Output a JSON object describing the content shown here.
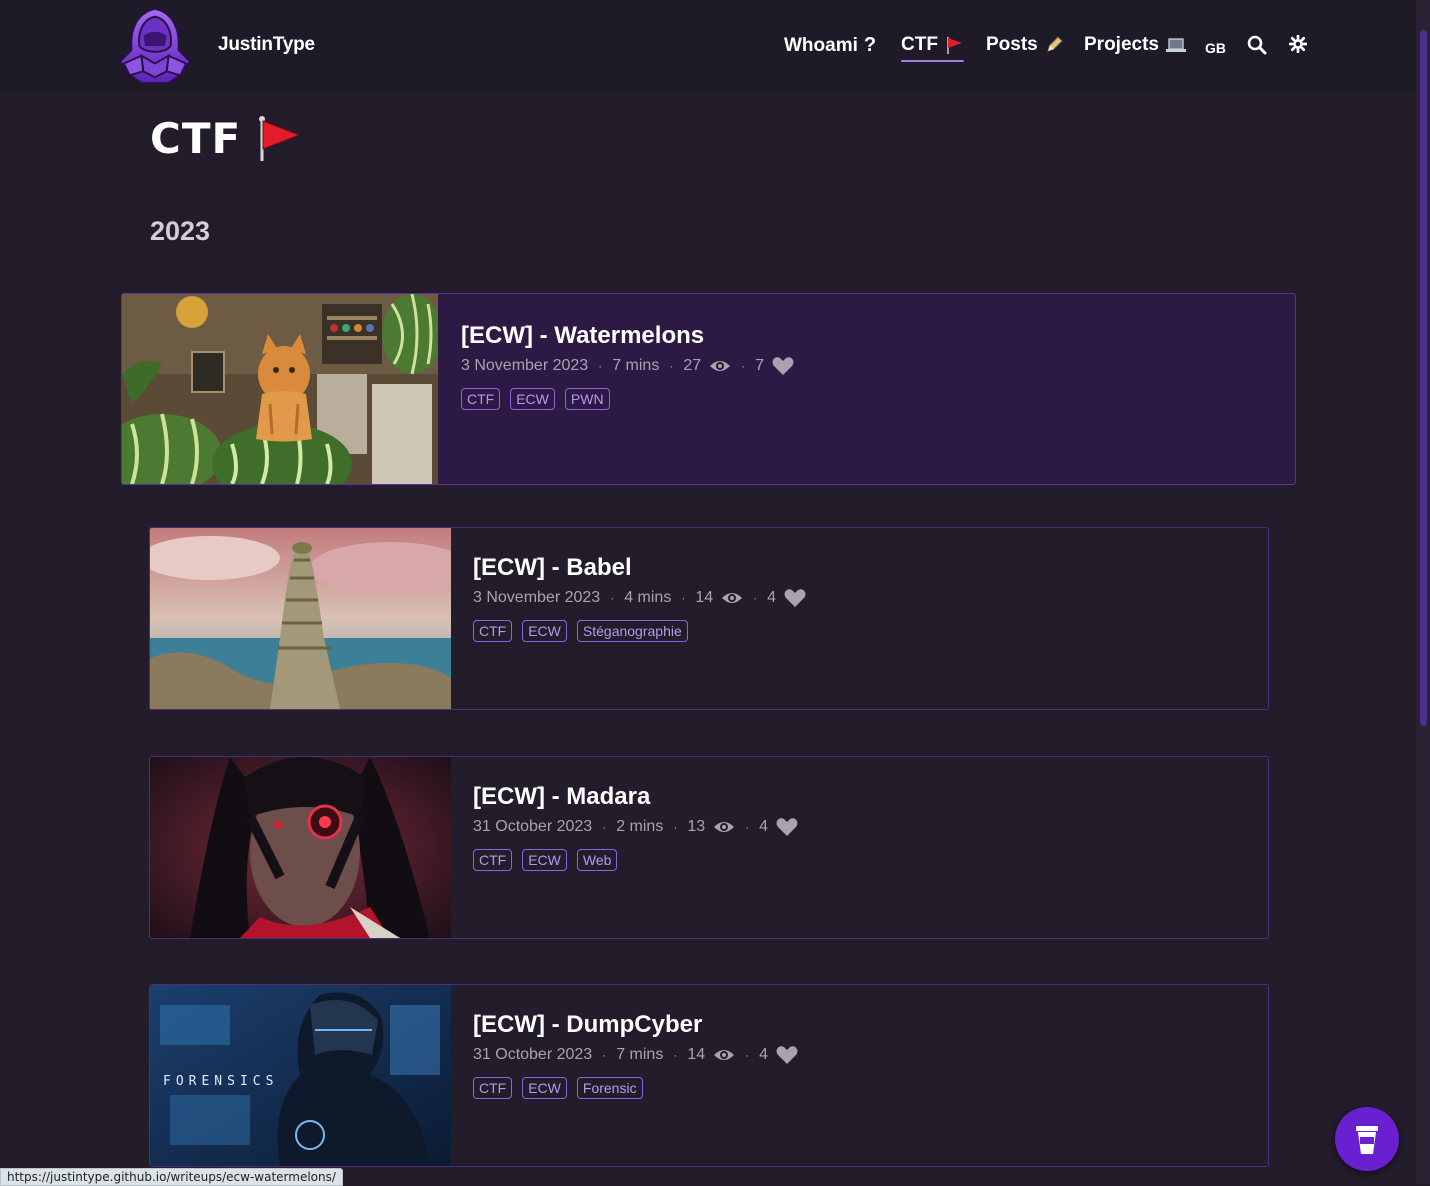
{
  "header": {
    "site_title": "JustinType",
    "nav": [
      {
        "label": "Whoami",
        "icon": "question-icon",
        "glyph": "?"
      },
      {
        "label": "CTF",
        "icon": "red-flag-icon",
        "active": true
      },
      {
        "label": "Posts",
        "icon": "pencil-icon"
      },
      {
        "label": "Projects",
        "icon": "laptop-icon"
      }
    ],
    "lang": "GB",
    "search_icon": "search-icon",
    "theme_icon": "gear-icon"
  },
  "page": {
    "title": "CTF",
    "year": "2023"
  },
  "posts": [
    {
      "title": "[ECW] - Watermelons",
      "date": "3 November 2023",
      "read_time": "7 mins",
      "views": "27",
      "likes": "7",
      "tags": [
        "CTF",
        "ECW",
        "PWN"
      ]
    },
    {
      "title": "[ECW] - Babel",
      "date": "3 November 2023",
      "read_time": "4 mins",
      "views": "14",
      "likes": "4",
      "tags": [
        "CTF",
        "ECW",
        "Stéganographie"
      ]
    },
    {
      "title": "[ECW] - Madara",
      "date": "31 October 2023",
      "read_time": "2 mins",
      "views": "13",
      "likes": "4",
      "tags": [
        "CTF",
        "ECW",
        "Web"
      ]
    },
    {
      "title": "[ECW] - DumpCyber",
      "date": "31 October 2023",
      "read_time": "7 mins",
      "views": "14",
      "likes": "4",
      "tags": [
        "CTF",
        "ECW",
        "Forensic"
      ]
    }
  ],
  "thumbnail_text": {
    "forensics": "FORENSICS"
  },
  "status_bar": "https://justintype.github.io/writeups/ecw-watermelons/",
  "colors": {
    "accent": "#8e63e0",
    "background": "#221c2b",
    "active_card": "#2d1a44",
    "coffee_button": "#6a1fd0"
  }
}
